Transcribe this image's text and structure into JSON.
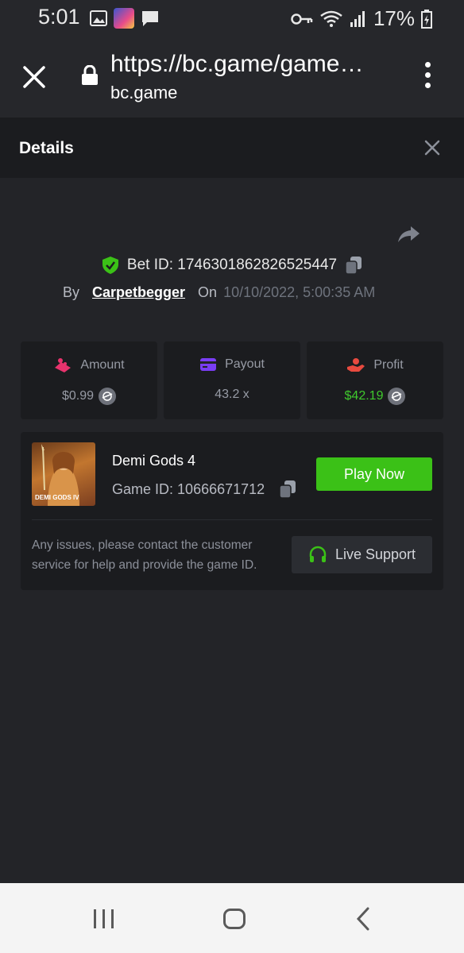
{
  "status_bar": {
    "time": "5:01",
    "battery": "17%"
  },
  "browser": {
    "url": "https://bc.game/game…",
    "domain": "bc.game"
  },
  "panel": {
    "title": "Details"
  },
  "bet": {
    "id_label": "Bet ID:",
    "id": "1746301862826525447",
    "by_label": "By",
    "user": "Carpetbegger",
    "on_label": "On",
    "datetime": "10/10/2022, 5:00:35 AM"
  },
  "stats": [
    {
      "label": "Amount",
      "value": "$0.99",
      "icon": "amount-icon",
      "color": "#e8336d"
    },
    {
      "label": "Payout",
      "value": "43.2 x",
      "icon": "payout-icon",
      "color": "#7a3df5"
    },
    {
      "label": "Profit",
      "value": "$42.19",
      "icon": "profit-icon",
      "color": "#e84a3f",
      "value_color": "#3fc92d"
    }
  ],
  "game": {
    "name": "Demi Gods 4",
    "id_label": "Game ID:",
    "id": "10666671712",
    "thumb_label": "DEMI GODS IV",
    "play_label": "Play Now",
    "issue_text": "Any issues, please contact the customer service for help and provide the game ID.",
    "support_label": "Live Support"
  },
  "colors": {
    "accent_green": "#3bc117",
    "background": "#232428",
    "card": "#1b1c1f"
  }
}
